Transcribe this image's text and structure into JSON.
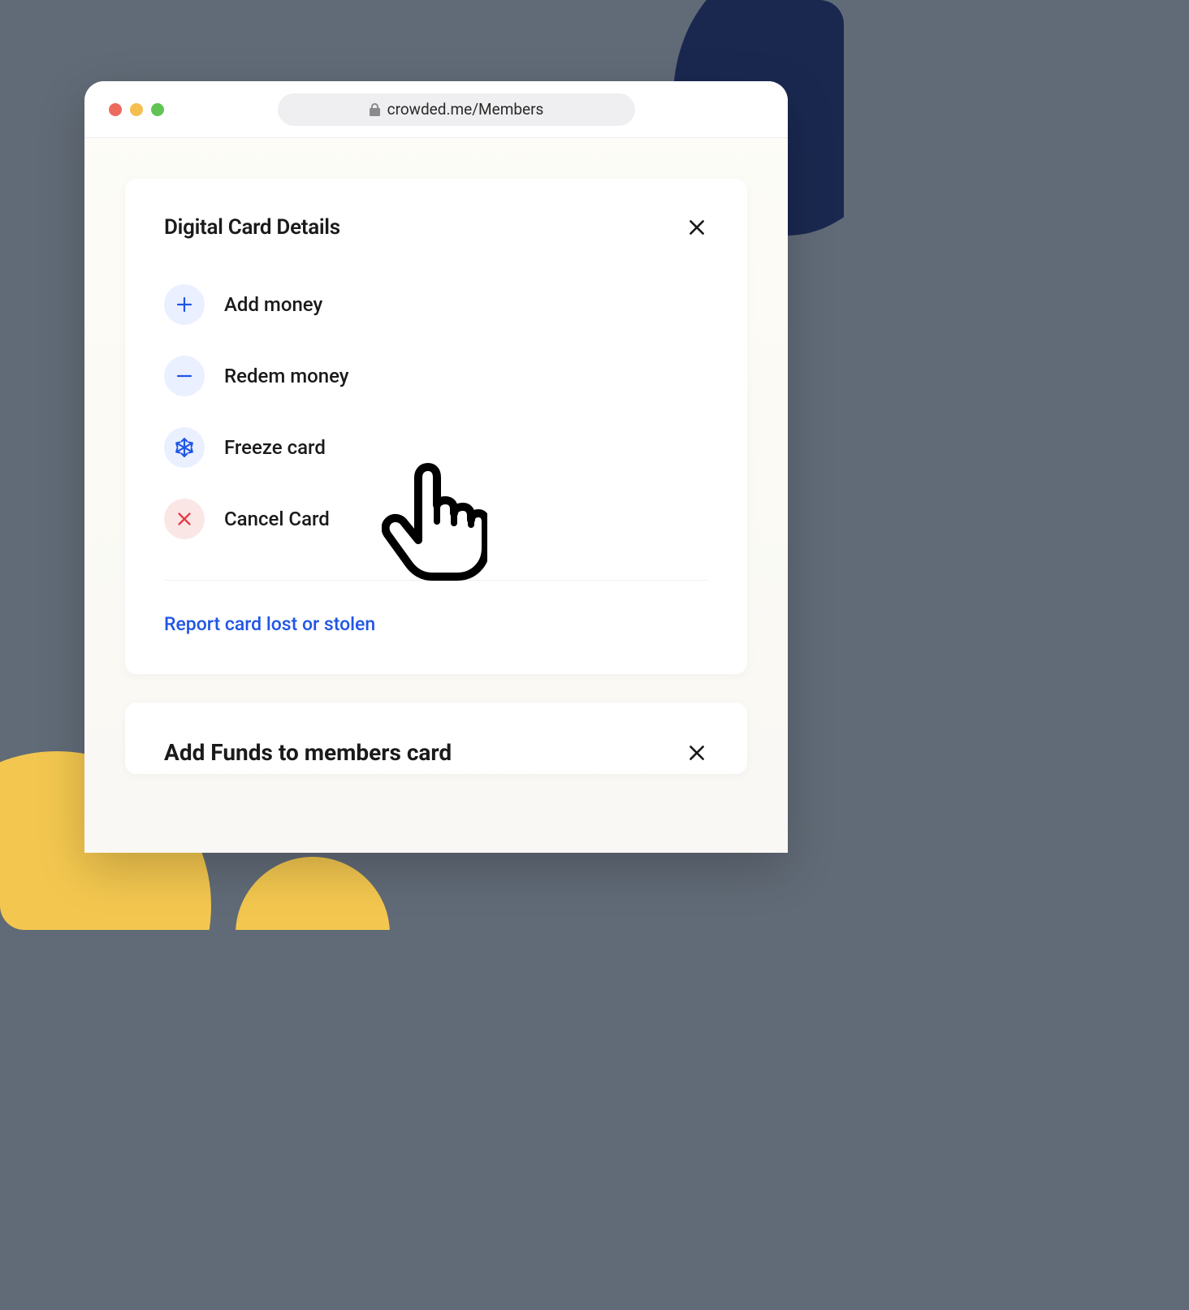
{
  "browser": {
    "url": "crowded.me/Members"
  },
  "panel1": {
    "title": "Digital Card Details",
    "actions": [
      {
        "label": "Add money",
        "icon": "plus-icon",
        "iconBg": "blue"
      },
      {
        "label": "Redem money",
        "icon": "minus-icon",
        "iconBg": "blue"
      },
      {
        "label": "Freeze card",
        "icon": "snowflake-icon",
        "iconBg": "blue"
      },
      {
        "label": "Cancel Card",
        "icon": "x-icon",
        "iconBg": "red"
      }
    ],
    "reportLink": "Report card lost or stolen"
  },
  "panel2": {
    "title": "Add Funds to members card"
  }
}
